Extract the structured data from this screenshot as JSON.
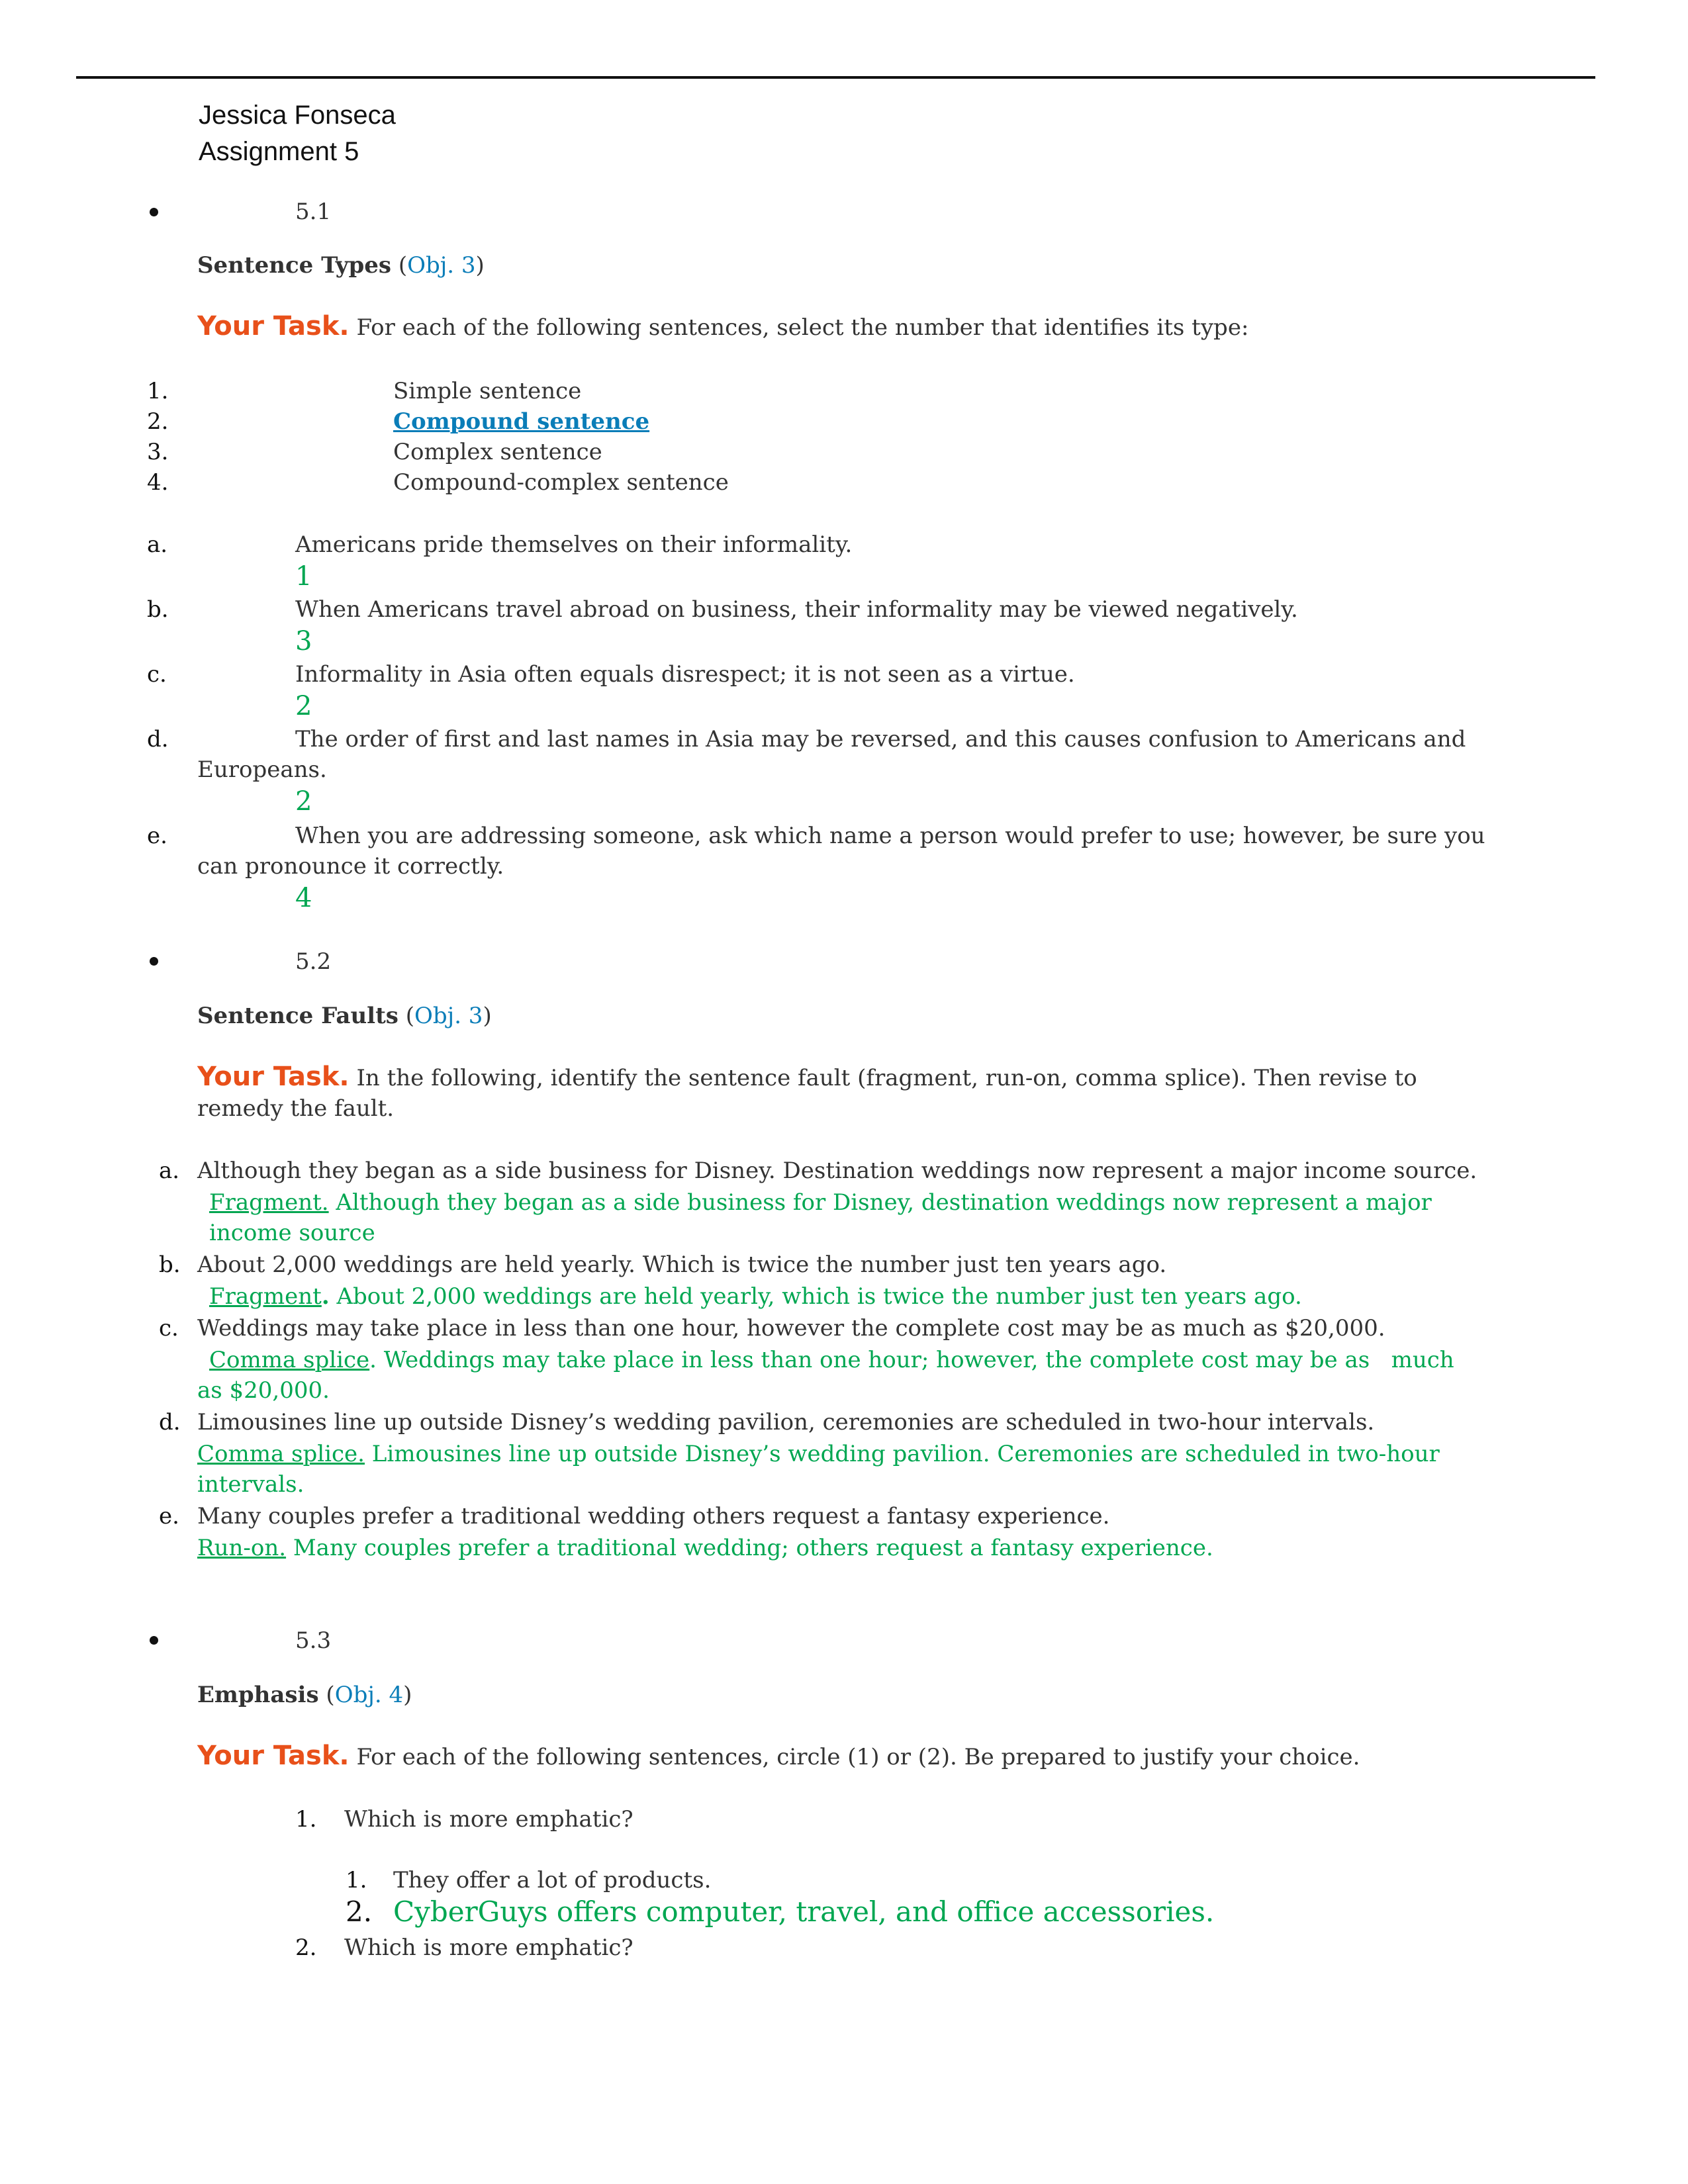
{
  "header": {
    "name": "Jessica Fonseca",
    "assignment": "Assignment 5"
  },
  "colors": {
    "accent_orange": "#E8501A",
    "link_blue": "#0A7DB8",
    "answer_green": "#00A651",
    "body_text": "#333333"
  },
  "sections": [
    {
      "number": "5.1",
      "title": "Sentence Types",
      "obj_open": " (",
      "obj": "Obj. 3",
      "obj_close": ")",
      "task_label": "Your Task.",
      "task_text": " For each of the following sentences, select the number that identifies its type:",
      "types": [
        {
          "num": "1.",
          "label": "Simple sentence"
        },
        {
          "num": "2.",
          "label": "Compound sentence"
        },
        {
          "num": "3.",
          "label": "Complex sentence"
        },
        {
          "num": "4.",
          "label": "Compound-complex sentence"
        }
      ],
      "items": [
        {
          "letter": "a.",
          "text": "Americans pride themselves on their informality.",
          "cont": "",
          "answer": "1"
        },
        {
          "letter": "b.",
          "text": "When Americans travel abroad on business, their informality may be viewed negatively.",
          "cont": "",
          "answer": "3"
        },
        {
          "letter": "c.",
          "text": "Informality in Asia often equals disrespect; it is not seen as a virtue.",
          "cont": "",
          "answer": "2"
        },
        {
          "letter": "d.",
          "text": "The order of first and last names in Asia may be reversed, and this causes confusion to Americans and",
          "cont": "Europeans.",
          "answer": "2"
        },
        {
          "letter": "e.",
          "text": "When you are addressing someone, ask which name a person would prefer to use; however, be sure you",
          "cont": "can pronounce it correctly.",
          "answer": "4"
        }
      ]
    },
    {
      "number": "5.2",
      "title": "Sentence Faults",
      "obj_open": " (",
      "obj": "Obj. 3",
      "obj_close": ")",
      "task_label": "Your Task.",
      "task_text": " In the following, identify the sentence fault (fragment, run-on, comma splice). Then revise to",
      "task_text_cont": "remedy the fault.",
      "items": [
        {
          "letter": "a.",
          "text": "Although they began as a side business for Disney. Destination weddings now represent a major income source.",
          "fault": "Fragment.",
          "revision": " Although they began as a side business for Disney, destination weddings now represent a major",
          "revision_cont": "income source"
        },
        {
          "letter": "b.",
          "text": "About 2,000 weddings are held yearly. Which is twice the number just ten years ago.",
          "fault": "Fragment",
          "fault_punct": ".",
          "revision": " About 2,000 weddings are held yearly, which is twice the number just ten years ago.",
          "revision_cont": ""
        },
        {
          "letter": "c.",
          "text": "Weddings may take place in less than one hour, however the complete cost may be as much as $20,000.",
          "fault": "Comma splice",
          "fault_punct": ".",
          "revision": " Weddings may take place in less than one hour; however, the complete cost may be as   much",
          "revision_cont": "as $20,000."
        },
        {
          "letter": "d.",
          "text": "Limousines line up outside Disney’s wedding pavilion, ceremonies are scheduled in two-hour intervals.",
          "fault": "Comma splice.",
          "revision": " Limousines line up outside Disney’s wedding pavilion. Ceremonies are scheduled in two-hour",
          "revision_cont": "intervals."
        },
        {
          "letter": "e.",
          "text": "Many couples prefer a traditional wedding others request a fantasy experience.",
          "fault": "Run-on.",
          "revision": " Many couples prefer a traditional wedding; others request a fantasy experience.",
          "revision_cont": ""
        }
      ]
    },
    {
      "number": "5.3",
      "title": "Emphasis",
      "obj_open": " (",
      "obj": "Obj. 4",
      "obj_close": ")",
      "task_label": "Your Task.",
      "task_text": " For each of the following sentences, circle (1) or (2). Be prepared to justify your choice.",
      "questions": [
        {
          "num": "1.",
          "text": "Which is more emphatic?",
          "options": [
            {
              "num": "1.",
              "text": "They offer a lot of products."
            },
            {
              "num": "2.",
              "text": "CyberGuys offers computer, travel, and office accessories.",
              "selected": true
            }
          ]
        },
        {
          "num": "2.",
          "text": "Which is more emphatic?"
        }
      ]
    }
  ]
}
